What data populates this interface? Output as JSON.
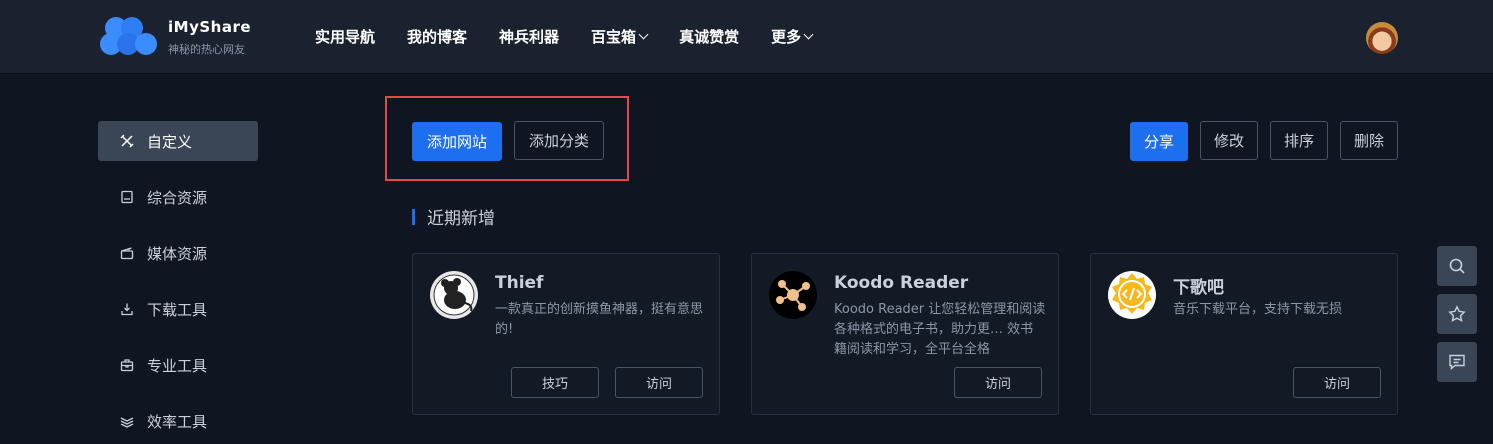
{
  "brand": {
    "title": "iMyShare",
    "subtitle": "神秘的热心网友"
  },
  "nav": [
    {
      "label": "实用导航",
      "dropdown": false
    },
    {
      "label": "我的博客",
      "dropdown": false
    },
    {
      "label": "神兵利器",
      "dropdown": false
    },
    {
      "label": "百宝箱",
      "dropdown": true
    },
    {
      "label": "真诚赞赏",
      "dropdown": false
    },
    {
      "label": "更多",
      "dropdown": true
    }
  ],
  "sidebar": {
    "items": [
      {
        "label": "自定义",
        "icon": "tools-icon",
        "active": true
      },
      {
        "label": "综合资源",
        "icon": "box-icon"
      },
      {
        "label": "媒体资源",
        "icon": "film-icon"
      },
      {
        "label": "下载工具",
        "icon": "download-icon"
      },
      {
        "label": "专业工具",
        "icon": "toolbox-icon"
      },
      {
        "label": "效率工具",
        "icon": "layers-icon"
      }
    ]
  },
  "actions": {
    "add_site": "添加网站",
    "add_category": "添加分类",
    "share": "分享",
    "edit": "修改",
    "sort": "排序",
    "delete": "删除"
  },
  "section": {
    "title": "近期新增"
  },
  "cards": [
    {
      "title": "Thief",
      "desc": "一款真正的创新摸鱼神器，挺有意思的!",
      "buttons": [
        "技巧",
        "访问"
      ],
      "icon": "thief-logo-icon"
    },
    {
      "title": "Koodo Reader",
      "desc": "Koodo Reader 让您轻松管理和阅读各种格式的电子书，助力更… 效书籍阅读和学习，全平台全格",
      "buttons": [
        "访问"
      ],
      "icon": "koodo-logo-icon"
    },
    {
      "title": "下歌吧",
      "desc": "音乐下载平台，支持下载无损",
      "buttons": [
        "访问"
      ],
      "icon": "xiageba-logo-icon"
    }
  ],
  "tools": [
    "search-icon",
    "star-icon",
    "comment-icon"
  ],
  "colors": {
    "accent": "#1e6ff0",
    "highlight": "#e54848",
    "background": "#0f1622",
    "header": "#1a2230"
  }
}
